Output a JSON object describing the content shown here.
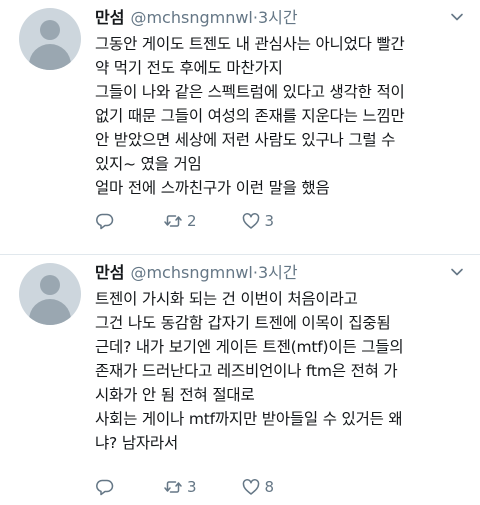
{
  "tweets": [
    {
      "name": "만섬",
      "handle": "@mchsngmnwl",
      "separator": "·",
      "time": "3시간",
      "lines": [
        "그동안 게이도 트젠도 내 관심사는 아니었다 빨간",
        "약 먹기 전도 후에도 마찬가지",
        "그들이 나와 같은 스펙트럼에 있다고 생각한 적이",
        "없기 때문 그들이 여성의 존재를 지운다는 느낌만",
        "안 받았으면 세상에 저런 사람도 있구나 그럴 수",
        "있지~ 였을 거임",
        "얼마 전에 스까친구가 이런 말을 했음"
      ],
      "reply_count": "",
      "retweet_count": "2",
      "like_count": "3"
    },
    {
      "name": "만섬",
      "handle": "@mchsngmnwl",
      "separator": "·",
      "time": "3시간",
      "lines": [
        "트젠이 가시화 되는 건 이번이 처음이라고",
        "그건 나도 동감함 갑자기 트젠에 이목이 집중됨",
        "근데? 내가 보기엔 게이든 트젠(mtf)이든 그들의",
        "존재가 드러난다고 레즈비언이나 ftm은 전혀 가",
        "시화가 안 됨 전혀 절대로",
        "사회는 게이나 mtf까지만 받아들일 수 있거든 왜",
        "냐? 남자라서"
      ],
      "reply_count": "",
      "retweet_count": "3",
      "like_count": "8"
    }
  ],
  "icons": {
    "avatar": "default-avatar",
    "more": "chevron-down-icon",
    "reply": "reply-icon",
    "retweet": "retweet-icon",
    "like": "heart-icon"
  },
  "colors": {
    "text": "#14171a",
    "secondary": "#657786",
    "divider": "#e1e8ed",
    "avatar_bg": "#cdd6dd"
  }
}
